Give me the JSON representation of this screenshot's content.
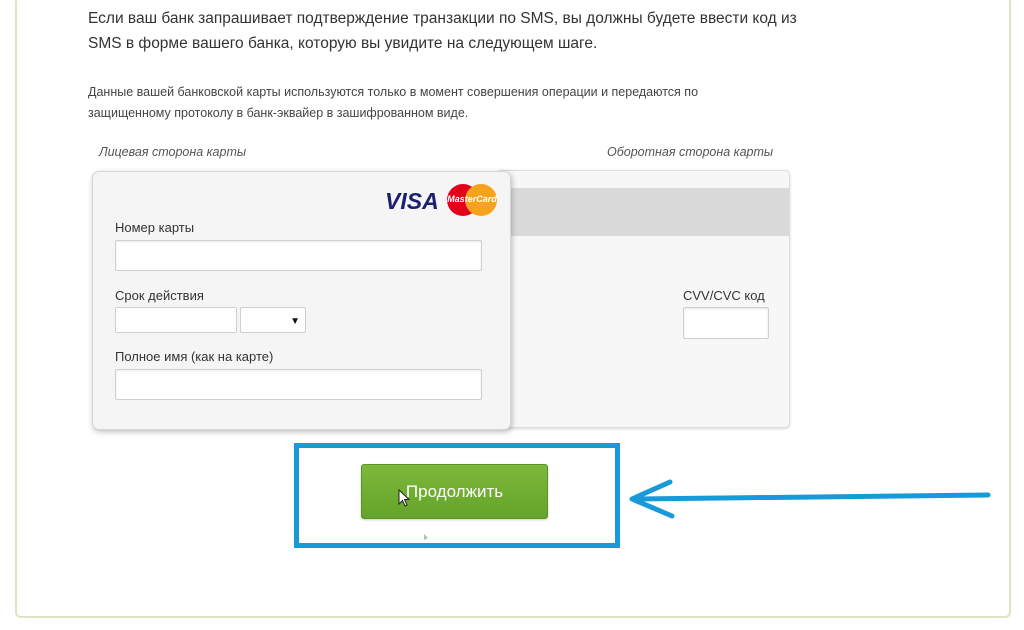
{
  "intro": {
    "line1": "Если ваш банк запрашивает подтверждение транзакции по SMS, вы должны будете ввести код из",
    "line2": "SMS в форме вашего банка, которую вы увидите на следующем шаге."
  },
  "security": {
    "line1": "Данные вашей банковской карты используются только в момент совершения операции и передаются по",
    "line2": "защищенному протоколу в банк-эквайер в зашифрованном виде."
  },
  "card": {
    "front_label": "Лицевая сторона карты",
    "back_label": "Оборотная сторона карты",
    "brand_visa": "VISA",
    "brand_mastercard": "MasterCard",
    "card_number_label": "Номер карты",
    "card_number_value": "",
    "expiry_label": "Срок действия",
    "expiry_month_value": "",
    "expiry_year_value": "",
    "name_label": "Полное имя (как на карте)",
    "name_value": "",
    "cvv_label": "CVV/CVC код",
    "cvv_value": ""
  },
  "actions": {
    "continue_label": "Продолжить"
  },
  "colors": {
    "button_green": "#6aaa2f",
    "highlight_blue": "#199ad8",
    "frame_border": "#dfe3c4"
  }
}
